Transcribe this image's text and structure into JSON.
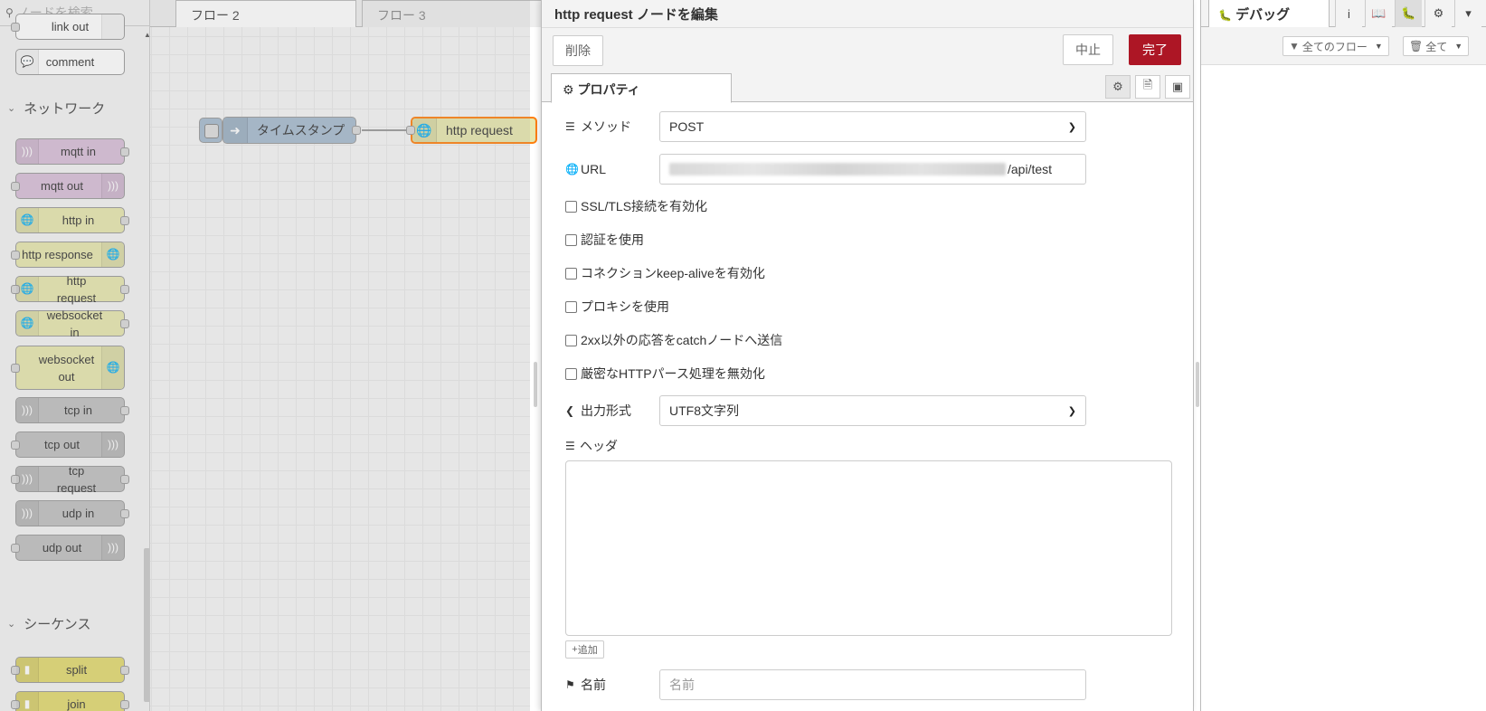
{
  "palette": {
    "search_placeholder": "ノードを検索",
    "categories": [
      {
        "label": "ネットワーク"
      },
      {
        "label": "シーケンス"
      }
    ],
    "nodes": {
      "link_out": "link out",
      "comment": "comment",
      "mqtt_in": "mqtt in",
      "mqtt_out": "mqtt out",
      "http_in": "http in",
      "http_response": "http response",
      "http_request": "http request",
      "websocket_in": "websocket in",
      "websocket_out_1": "websocket",
      "websocket_out_2": "out",
      "tcp_in": "tcp in",
      "tcp_out": "tcp out",
      "tcp_request": "tcp request",
      "udp_in": "udp in",
      "udp_out": "udp out",
      "split": "split",
      "join": "join"
    }
  },
  "workspace": {
    "tabs": [
      {
        "label": "フロー 2",
        "active": true
      },
      {
        "label": "フロー 3",
        "active": false
      }
    ],
    "flow_nodes": {
      "inject": "タイムスタンプ",
      "http_request": "http request"
    }
  },
  "editor": {
    "title": "http request ノードを編集",
    "delete_label": "削除",
    "cancel_label": "中止",
    "done_label": "完了",
    "properties_tab": "プロパティ",
    "method_label": "メソッド",
    "method_value": "POST",
    "url_label": "URL",
    "url_visible_suffix": "/api/test",
    "checkboxes": [
      "SSL/TLS接続を有効化",
      "認証を使用",
      "コネクションkeep-aliveを有効化",
      "プロキシを使用",
      "2xx以外の応答をcatchノードへ送信",
      "厳密なHTTPパース処理を無効化"
    ],
    "return_label": "出力形式",
    "return_value": "UTF8文字列",
    "headers_label": "ヘッダ",
    "add_label": "追加",
    "name_label": "名前",
    "name_placeholder": "名前"
  },
  "sidebar": {
    "debug_tab": "デバッグ",
    "filter_label": "全てのフロー",
    "clear_label": "全て"
  },
  "colors": {
    "primary_button": "#ad1625",
    "mqtt_node": "#d8bfd8",
    "http_node": "#e7e7ae",
    "tcp_node": "#c0c0c0",
    "inject_node": "#a6bbcf",
    "sequence_node": "#e2d96e"
  }
}
